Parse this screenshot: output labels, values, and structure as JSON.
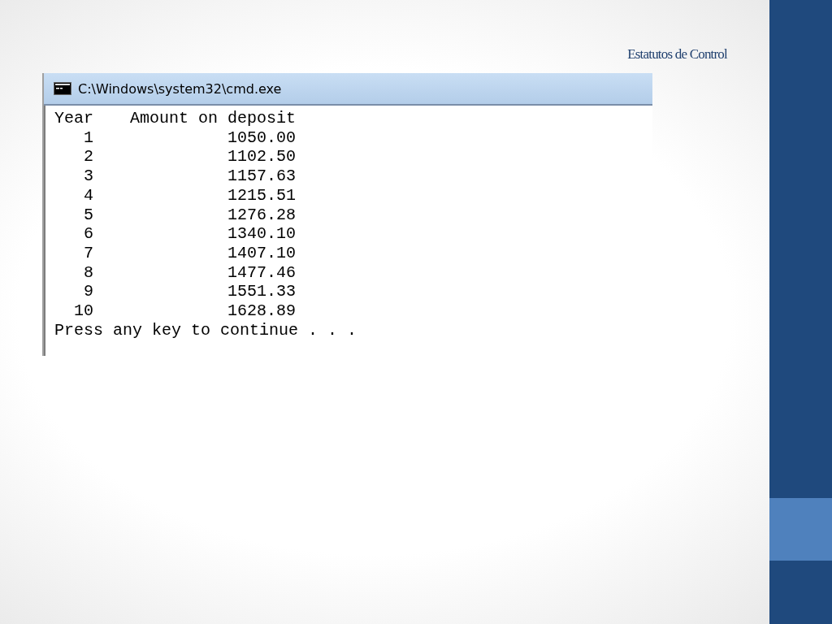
{
  "slide": {
    "title": "Estatutos de Control"
  },
  "console": {
    "title": "C:\\Windows\\system32\\cmd.exe",
    "header": {
      "column_1": "Year",
      "column_2": "Amount on deposit"
    },
    "rows": [
      {
        "year": "1",
        "amount": "1050.00"
      },
      {
        "year": "2",
        "amount": "1102.50"
      },
      {
        "year": "3",
        "amount": "1157.63"
      },
      {
        "year": "4",
        "amount": "1215.51"
      },
      {
        "year": "5",
        "amount": "1276.28"
      },
      {
        "year": "6",
        "amount": "1340.10"
      },
      {
        "year": "7",
        "amount": "1407.10"
      },
      {
        "year": "8",
        "amount": "1477.46"
      },
      {
        "year": "9",
        "amount": "1551.33"
      },
      {
        "year": "10",
        "amount": "1628.89"
      }
    ],
    "prompt": "Press any key to continue . . ."
  }
}
